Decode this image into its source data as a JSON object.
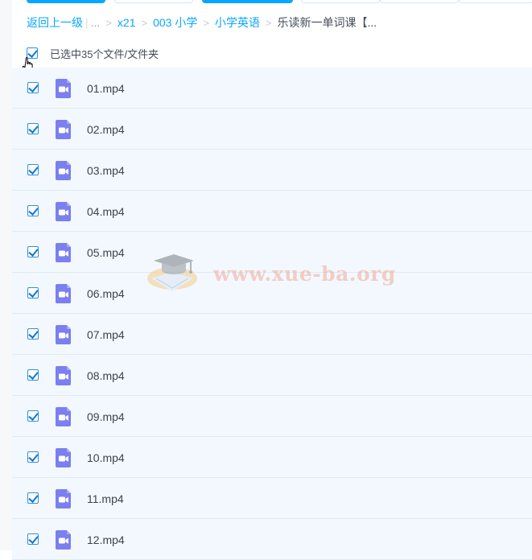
{
  "breadcrumb": {
    "back": "返回上一级",
    "ellipsis": "...",
    "separator": ">",
    "items": [
      "x21",
      "003 小学",
      "小学英语"
    ],
    "current": "乐读新一单词课【..."
  },
  "selection": {
    "label": "已选中35个文件/文件夹",
    "checked": true
  },
  "files": [
    {
      "name": "01.mp4",
      "type": "video",
      "checked": true
    },
    {
      "name": "02.mp4",
      "type": "video",
      "checked": true
    },
    {
      "name": "03.mp4",
      "type": "video",
      "checked": true
    },
    {
      "name": "04.mp4",
      "type": "video",
      "checked": true
    },
    {
      "name": "05.mp4",
      "type": "video",
      "checked": true
    },
    {
      "name": "06.mp4",
      "type": "video",
      "checked": true
    },
    {
      "name": "07.mp4",
      "type": "video",
      "checked": true
    },
    {
      "name": "08.mp4",
      "type": "video",
      "checked": true
    },
    {
      "name": "09.mp4",
      "type": "video",
      "checked": true
    },
    {
      "name": "10.mp4",
      "type": "video",
      "checked": true
    },
    {
      "name": "11.mp4",
      "type": "video",
      "checked": true
    },
    {
      "name": "12.mp4",
      "type": "video",
      "checked": true
    }
  ],
  "watermark": {
    "text": "www.xue-ba.org",
    "icon": "graduation-cap-book-icon"
  },
  "colors": {
    "accent": "#06a7ff",
    "row_background": "#f2f8fe",
    "video_icon": "#7b7ff0",
    "checkbox": "#0c78d6"
  }
}
